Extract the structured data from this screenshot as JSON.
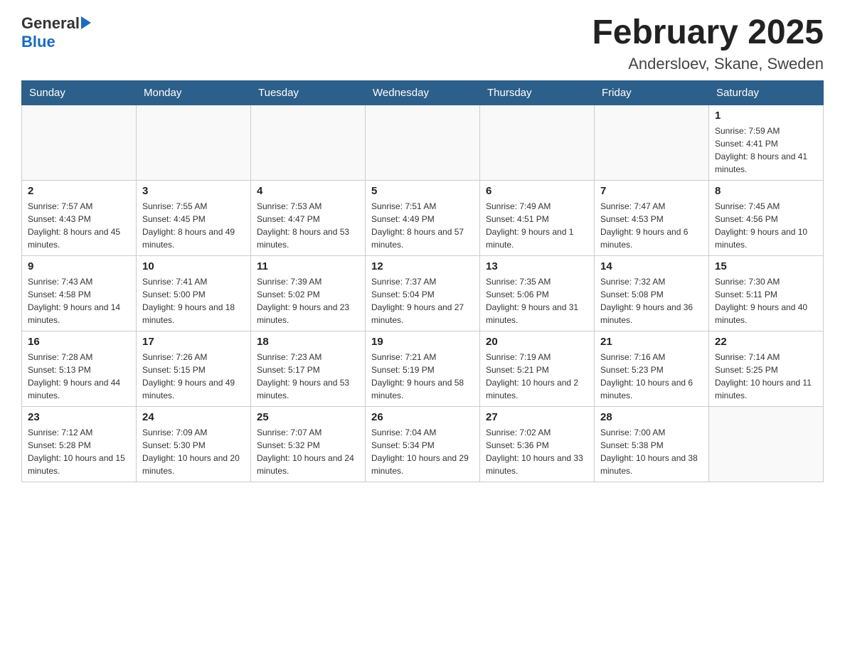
{
  "header": {
    "logo_general": "General",
    "logo_blue": "Blue",
    "month_title": "February 2025",
    "location": "Andersloev, Skane, Sweden"
  },
  "weekdays": [
    "Sunday",
    "Monday",
    "Tuesday",
    "Wednesday",
    "Thursday",
    "Friday",
    "Saturday"
  ],
  "weeks": [
    [
      {
        "day": "",
        "sunrise": "",
        "sunset": "",
        "daylight": "",
        "empty": true
      },
      {
        "day": "",
        "sunrise": "",
        "sunset": "",
        "daylight": "",
        "empty": true
      },
      {
        "day": "",
        "sunrise": "",
        "sunset": "",
        "daylight": "",
        "empty": true
      },
      {
        "day": "",
        "sunrise": "",
        "sunset": "",
        "daylight": "",
        "empty": true
      },
      {
        "day": "",
        "sunrise": "",
        "sunset": "",
        "daylight": "",
        "empty": true
      },
      {
        "day": "",
        "sunrise": "",
        "sunset": "",
        "daylight": "",
        "empty": true
      },
      {
        "day": "1",
        "sunrise": "Sunrise: 7:59 AM",
        "sunset": "Sunset: 4:41 PM",
        "daylight": "Daylight: 8 hours and 41 minutes.",
        "empty": false
      }
    ],
    [
      {
        "day": "2",
        "sunrise": "Sunrise: 7:57 AM",
        "sunset": "Sunset: 4:43 PM",
        "daylight": "Daylight: 8 hours and 45 minutes.",
        "empty": false
      },
      {
        "day": "3",
        "sunrise": "Sunrise: 7:55 AM",
        "sunset": "Sunset: 4:45 PM",
        "daylight": "Daylight: 8 hours and 49 minutes.",
        "empty": false
      },
      {
        "day": "4",
        "sunrise": "Sunrise: 7:53 AM",
        "sunset": "Sunset: 4:47 PM",
        "daylight": "Daylight: 8 hours and 53 minutes.",
        "empty": false
      },
      {
        "day": "5",
        "sunrise": "Sunrise: 7:51 AM",
        "sunset": "Sunset: 4:49 PM",
        "daylight": "Daylight: 8 hours and 57 minutes.",
        "empty": false
      },
      {
        "day": "6",
        "sunrise": "Sunrise: 7:49 AM",
        "sunset": "Sunset: 4:51 PM",
        "daylight": "Daylight: 9 hours and 1 minute.",
        "empty": false
      },
      {
        "day": "7",
        "sunrise": "Sunrise: 7:47 AM",
        "sunset": "Sunset: 4:53 PM",
        "daylight": "Daylight: 9 hours and 6 minutes.",
        "empty": false
      },
      {
        "day": "8",
        "sunrise": "Sunrise: 7:45 AM",
        "sunset": "Sunset: 4:56 PM",
        "daylight": "Daylight: 9 hours and 10 minutes.",
        "empty": false
      }
    ],
    [
      {
        "day": "9",
        "sunrise": "Sunrise: 7:43 AM",
        "sunset": "Sunset: 4:58 PM",
        "daylight": "Daylight: 9 hours and 14 minutes.",
        "empty": false
      },
      {
        "day": "10",
        "sunrise": "Sunrise: 7:41 AM",
        "sunset": "Sunset: 5:00 PM",
        "daylight": "Daylight: 9 hours and 18 minutes.",
        "empty": false
      },
      {
        "day": "11",
        "sunrise": "Sunrise: 7:39 AM",
        "sunset": "Sunset: 5:02 PM",
        "daylight": "Daylight: 9 hours and 23 minutes.",
        "empty": false
      },
      {
        "day": "12",
        "sunrise": "Sunrise: 7:37 AM",
        "sunset": "Sunset: 5:04 PM",
        "daylight": "Daylight: 9 hours and 27 minutes.",
        "empty": false
      },
      {
        "day": "13",
        "sunrise": "Sunrise: 7:35 AM",
        "sunset": "Sunset: 5:06 PM",
        "daylight": "Daylight: 9 hours and 31 minutes.",
        "empty": false
      },
      {
        "day": "14",
        "sunrise": "Sunrise: 7:32 AM",
        "sunset": "Sunset: 5:08 PM",
        "daylight": "Daylight: 9 hours and 36 minutes.",
        "empty": false
      },
      {
        "day": "15",
        "sunrise": "Sunrise: 7:30 AM",
        "sunset": "Sunset: 5:11 PM",
        "daylight": "Daylight: 9 hours and 40 minutes.",
        "empty": false
      }
    ],
    [
      {
        "day": "16",
        "sunrise": "Sunrise: 7:28 AM",
        "sunset": "Sunset: 5:13 PM",
        "daylight": "Daylight: 9 hours and 44 minutes.",
        "empty": false
      },
      {
        "day": "17",
        "sunrise": "Sunrise: 7:26 AM",
        "sunset": "Sunset: 5:15 PM",
        "daylight": "Daylight: 9 hours and 49 minutes.",
        "empty": false
      },
      {
        "day": "18",
        "sunrise": "Sunrise: 7:23 AM",
        "sunset": "Sunset: 5:17 PM",
        "daylight": "Daylight: 9 hours and 53 minutes.",
        "empty": false
      },
      {
        "day": "19",
        "sunrise": "Sunrise: 7:21 AM",
        "sunset": "Sunset: 5:19 PM",
        "daylight": "Daylight: 9 hours and 58 minutes.",
        "empty": false
      },
      {
        "day": "20",
        "sunrise": "Sunrise: 7:19 AM",
        "sunset": "Sunset: 5:21 PM",
        "daylight": "Daylight: 10 hours and 2 minutes.",
        "empty": false
      },
      {
        "day": "21",
        "sunrise": "Sunrise: 7:16 AM",
        "sunset": "Sunset: 5:23 PM",
        "daylight": "Daylight: 10 hours and 6 minutes.",
        "empty": false
      },
      {
        "day": "22",
        "sunrise": "Sunrise: 7:14 AM",
        "sunset": "Sunset: 5:25 PM",
        "daylight": "Daylight: 10 hours and 11 minutes.",
        "empty": false
      }
    ],
    [
      {
        "day": "23",
        "sunrise": "Sunrise: 7:12 AM",
        "sunset": "Sunset: 5:28 PM",
        "daylight": "Daylight: 10 hours and 15 minutes.",
        "empty": false
      },
      {
        "day": "24",
        "sunrise": "Sunrise: 7:09 AM",
        "sunset": "Sunset: 5:30 PM",
        "daylight": "Daylight: 10 hours and 20 minutes.",
        "empty": false
      },
      {
        "day": "25",
        "sunrise": "Sunrise: 7:07 AM",
        "sunset": "Sunset: 5:32 PM",
        "daylight": "Daylight: 10 hours and 24 minutes.",
        "empty": false
      },
      {
        "day": "26",
        "sunrise": "Sunrise: 7:04 AM",
        "sunset": "Sunset: 5:34 PM",
        "daylight": "Daylight: 10 hours and 29 minutes.",
        "empty": false
      },
      {
        "day": "27",
        "sunrise": "Sunrise: 7:02 AM",
        "sunset": "Sunset: 5:36 PM",
        "daylight": "Daylight: 10 hours and 33 minutes.",
        "empty": false
      },
      {
        "day": "28",
        "sunrise": "Sunrise: 7:00 AM",
        "sunset": "Sunset: 5:38 PM",
        "daylight": "Daylight: 10 hours and 38 minutes.",
        "empty": false
      },
      {
        "day": "",
        "sunrise": "",
        "sunset": "",
        "daylight": "",
        "empty": true
      }
    ]
  ]
}
